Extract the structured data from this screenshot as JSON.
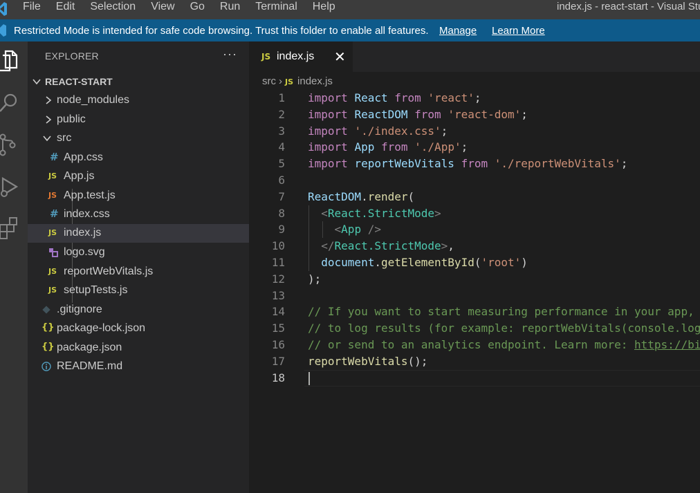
{
  "titlebar": {
    "menu": [
      "File",
      "Edit",
      "Selection",
      "View",
      "Go",
      "Run",
      "Terminal",
      "Help"
    ],
    "window_title": "index.js - react-start - Visual Stu"
  },
  "banner": {
    "message": "Restricted Mode is intended for safe code browsing. Trust this folder to enable all features.",
    "manage": "Manage",
    "learn_more": "Learn More",
    "color": "#0e5a8a"
  },
  "activitybar": {
    "icons": [
      "explorer-icon",
      "search-icon",
      "source-control-icon",
      "run-debug-icon",
      "extensions-icon"
    ]
  },
  "sidebar": {
    "title": "EXPLORER",
    "more": "···",
    "project": "REACT-START",
    "items": [
      {
        "label": "node_modules",
        "type": "folder-collapsed"
      },
      {
        "label": "public",
        "type": "folder-collapsed"
      },
      {
        "label": "src",
        "type": "folder-expanded"
      },
      {
        "label": "App.css",
        "icon": "#",
        "icon_color": "#519aba"
      },
      {
        "label": "App.js",
        "icon": "JS",
        "icon_color": "#cbcb41"
      },
      {
        "label": "App.test.js",
        "icon": "JS",
        "icon_color": "#e37933"
      },
      {
        "label": "index.css",
        "icon": "#",
        "icon_color": "#519aba"
      },
      {
        "label": "index.js",
        "icon": "JS",
        "icon_color": "#cbcb41",
        "selected": true
      },
      {
        "label": "logo.svg",
        "icon": "svg-icon",
        "icon_color": "#a074c4"
      },
      {
        "label": "reportWebVitals.js",
        "icon": "JS",
        "icon_color": "#cbcb41"
      },
      {
        "label": "setupTests.js",
        "icon": "JS",
        "icon_color": "#cbcb41"
      },
      {
        "label": ".gitignore",
        "icon": "git-icon",
        "icon_color": "#41535b"
      },
      {
        "label": "package-lock.json",
        "icon": "{}",
        "icon_color": "#cbcb41"
      },
      {
        "label": "package.json",
        "icon": "{}",
        "icon_color": "#cbcb41"
      },
      {
        "label": "README.md",
        "icon": "info-icon",
        "icon_color": "#519aba"
      }
    ]
  },
  "editor": {
    "tab": {
      "icon": "JS",
      "label": "index.js",
      "close": "✕"
    },
    "breadcrumb": {
      "folder": "src",
      "sep": "›",
      "icon": "JS",
      "file": "index.js"
    },
    "active_line": 18,
    "lines": [
      [
        [
          "kw",
          "import"
        ],
        [
          "plain",
          " "
        ],
        [
          "var",
          "React"
        ],
        [
          "plain",
          " "
        ],
        [
          "kw",
          "from"
        ],
        [
          "plain",
          " "
        ],
        [
          "str",
          "'react'"
        ],
        [
          "plain",
          ";"
        ]
      ],
      [
        [
          "kw",
          "import"
        ],
        [
          "plain",
          " "
        ],
        [
          "var",
          "ReactDOM"
        ],
        [
          "plain",
          " "
        ],
        [
          "kw",
          "from"
        ],
        [
          "plain",
          " "
        ],
        [
          "str",
          "'react-dom'"
        ],
        [
          "plain",
          ";"
        ]
      ],
      [
        [
          "kw",
          "import"
        ],
        [
          "plain",
          " "
        ],
        [
          "str",
          "'./index.css'"
        ],
        [
          "plain",
          ";"
        ]
      ],
      [
        [
          "kw",
          "import"
        ],
        [
          "plain",
          " "
        ],
        [
          "var",
          "App"
        ],
        [
          "plain",
          " "
        ],
        [
          "kw",
          "from"
        ],
        [
          "plain",
          " "
        ],
        [
          "str",
          "'./App'"
        ],
        [
          "plain",
          ";"
        ]
      ],
      [
        [
          "kw",
          "import"
        ],
        [
          "plain",
          " "
        ],
        [
          "var",
          "reportWebVitals"
        ],
        [
          "plain",
          " "
        ],
        [
          "kw",
          "from"
        ],
        [
          "plain",
          " "
        ],
        [
          "str",
          "'./reportWebVitals'"
        ],
        [
          "plain",
          ";"
        ]
      ],
      [],
      [
        [
          "var",
          "ReactDOM"
        ],
        [
          "plain",
          "."
        ],
        [
          "fn",
          "render"
        ],
        [
          "plain",
          "("
        ]
      ],
      [
        [
          "plain",
          "  "
        ],
        [
          "punc",
          "<"
        ],
        [
          "tag",
          "React.StrictMode"
        ],
        [
          "punc",
          ">"
        ]
      ],
      [
        [
          "plain",
          "    "
        ],
        [
          "punc",
          "<"
        ],
        [
          "tag",
          "App"
        ],
        [
          "plain",
          " "
        ],
        [
          "punc",
          "/>"
        ]
      ],
      [
        [
          "plain",
          "  "
        ],
        [
          "punc",
          "</"
        ],
        [
          "tag",
          "React.StrictMode"
        ],
        [
          "punc",
          ">"
        ],
        [
          "plain",
          ","
        ]
      ],
      [
        [
          "plain",
          "  "
        ],
        [
          "var",
          "document"
        ],
        [
          "plain",
          "."
        ],
        [
          "fn",
          "getElementById"
        ],
        [
          "plain",
          "("
        ],
        [
          "str",
          "'root'"
        ],
        [
          "plain",
          ")"
        ]
      ],
      [
        [
          "plain",
          ");"
        ]
      ],
      [],
      [
        [
          "cmt",
          "// If you want to start measuring performance in your app, "
        ]
      ],
      [
        [
          "cmt",
          "// to log results (for example: reportWebVitals(console.log"
        ]
      ],
      [
        [
          "cmt",
          "// or send to an analytics endpoint. Learn more: "
        ],
        [
          "url",
          "https://bi"
        ]
      ],
      [
        [
          "fn",
          "reportWebVitals"
        ],
        [
          "plain",
          "();"
        ]
      ],
      []
    ]
  }
}
